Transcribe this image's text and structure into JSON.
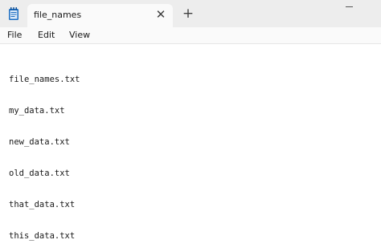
{
  "tab": {
    "title": "file_names",
    "close_glyph": "✕"
  },
  "new_tab_glyph": "+",
  "menu": {
    "file": "File",
    "edit": "Edit",
    "view": "View"
  },
  "editor": {
    "lines": [
      "file_names.txt",
      "my_data.txt",
      "new_data.txt",
      "old_data.txt",
      "that_data.txt",
      "this_data.txt"
    ]
  },
  "icons": {
    "app": "notepad-icon",
    "close": "close-icon",
    "new_tab": "plus-icon",
    "minimize": "minimize-icon"
  },
  "colors": {
    "titlebar": "#ededed",
    "tab": "#fafafa",
    "editor_bg": "#ffffff",
    "text": "#1a1a1a",
    "notepad_icon_blue": "#1f6fc2"
  }
}
